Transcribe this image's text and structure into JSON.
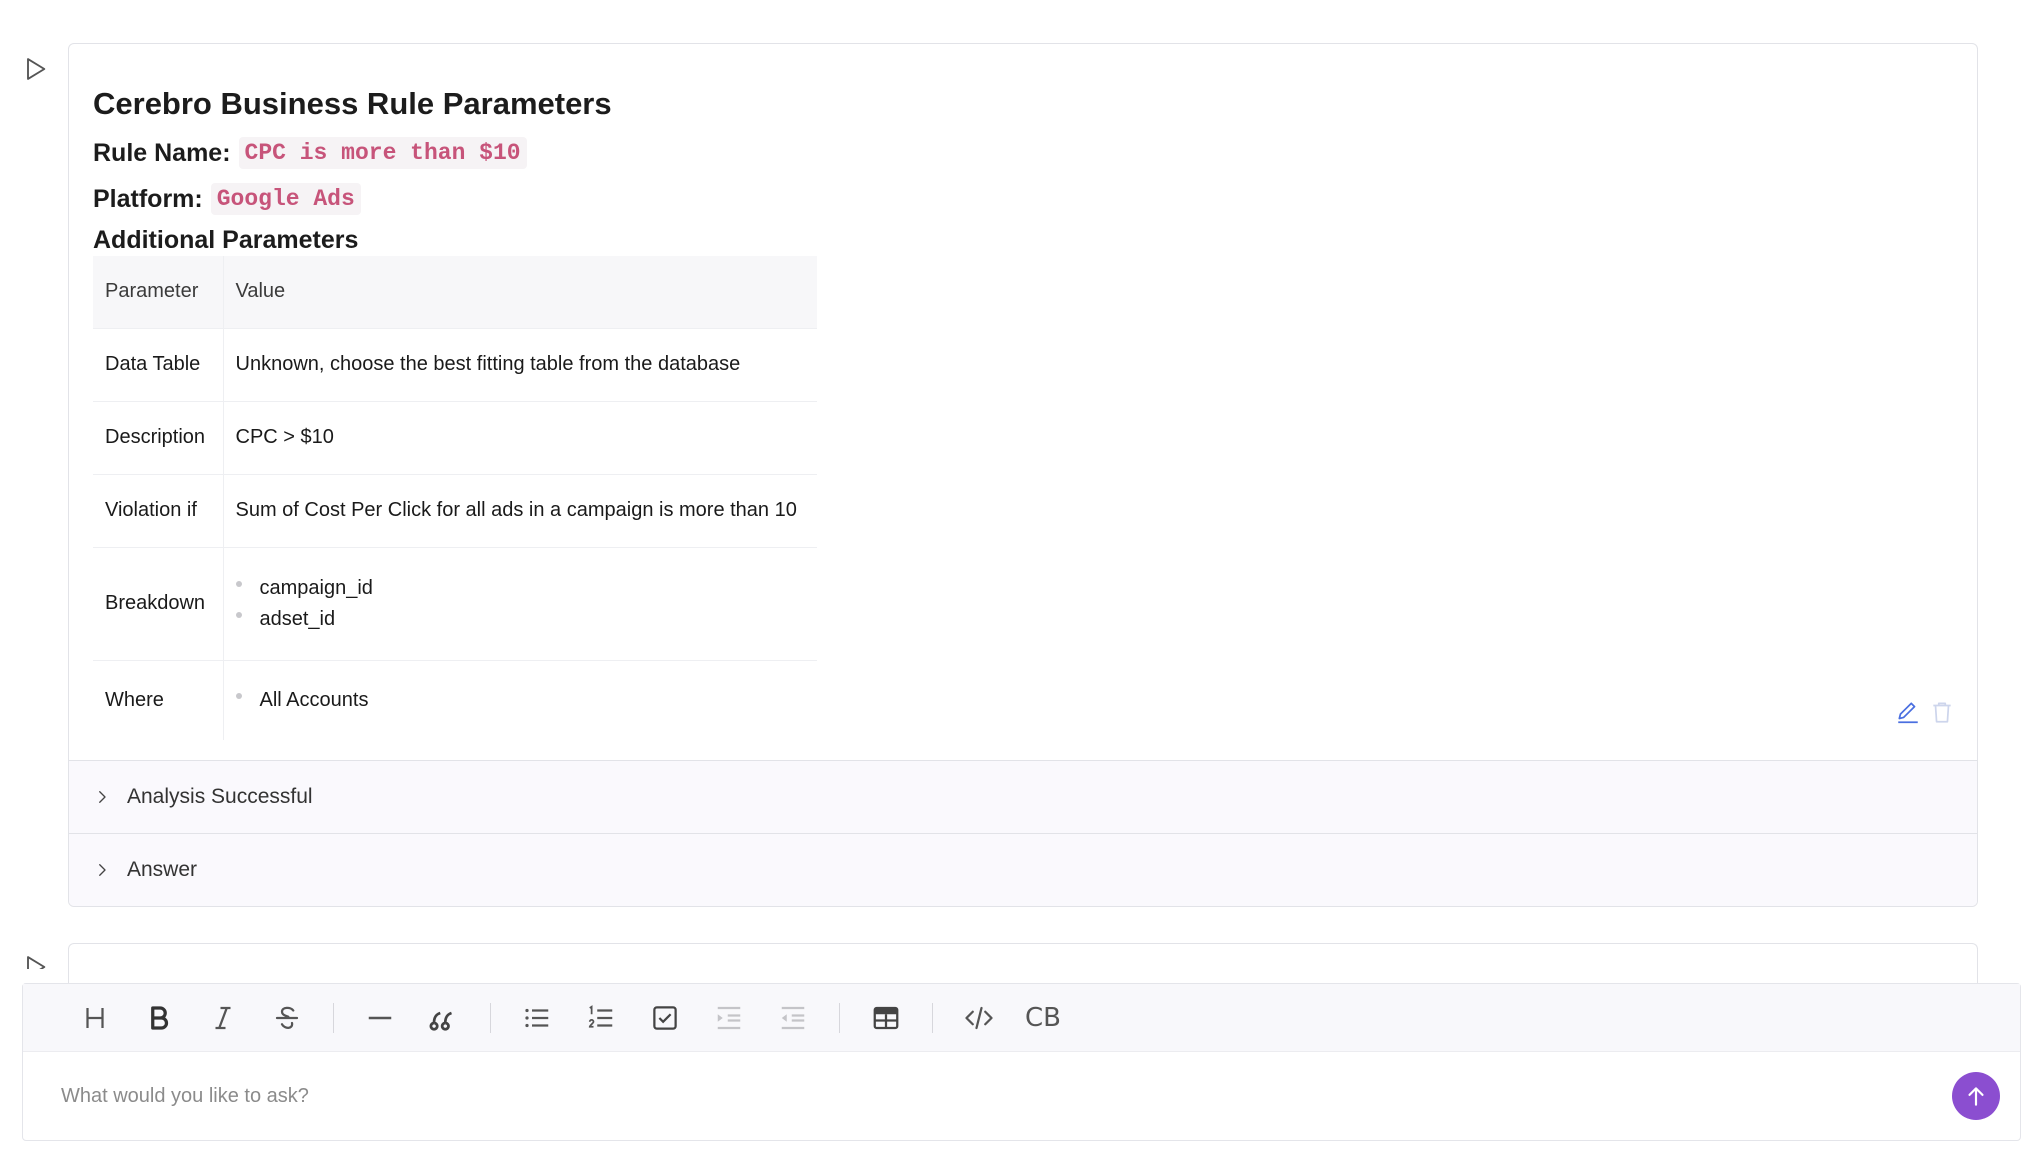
{
  "rule_card": {
    "title": "Cerebro Business Rule Parameters",
    "rule_name_label": "Rule Name:",
    "rule_name_value": "CPC is more than $10",
    "platform_label": "Platform:",
    "platform_value": "Google Ads",
    "additional_heading": "Additional Parameters",
    "table": {
      "headers": [
        "Parameter",
        "Value"
      ],
      "rows": [
        {
          "param": "Data Table",
          "value": "Unknown, choose the best fitting table from the database"
        },
        {
          "param": "Description",
          "value": "CPC > $10"
        },
        {
          "param": "Violation if",
          "value": "Sum of Cost Per Click for all ads in a campaign is more than 10"
        },
        {
          "param": "Breakdown",
          "items": [
            "campaign_id",
            "adset_id"
          ]
        },
        {
          "param": "Where",
          "items": [
            "All Accounts"
          ]
        }
      ]
    },
    "sections": [
      {
        "label": "Analysis Successful"
      },
      {
        "label": "Answer"
      }
    ]
  },
  "composer": {
    "placeholder": "What would you like to ask?",
    "toolbar_cb_label": "CB"
  },
  "colors": {
    "accent": "#8b4ed0",
    "code_text": "#c7547a",
    "edit_icon": "#4a6fe0"
  },
  "icons": [
    "play-icon",
    "edit-icon",
    "trash-icon",
    "chevron-right-icon",
    "heading-icon",
    "bold-icon",
    "italic-icon",
    "strikethrough-icon",
    "horizontal-rule-icon",
    "quote-icon",
    "bullet-list-icon",
    "ordered-list-icon",
    "task-list-icon",
    "indent-icon",
    "outdent-icon",
    "table-icon",
    "code-icon",
    "arrow-up-icon"
  ]
}
